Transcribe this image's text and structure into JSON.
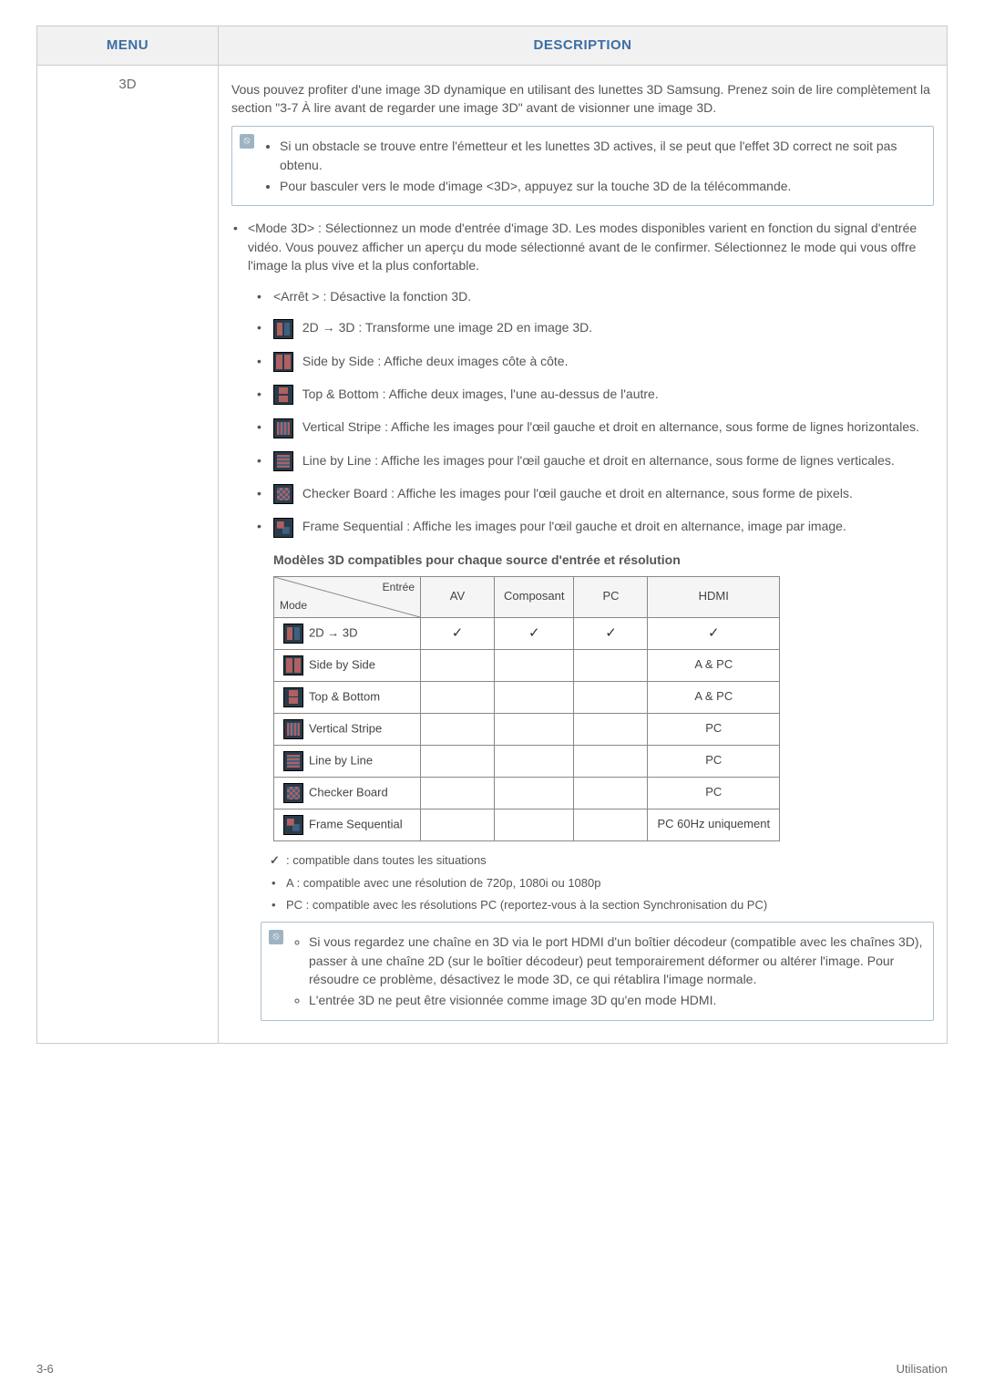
{
  "header": {
    "col_menu": "MENU",
    "col_desc": "DESCRIPTION"
  },
  "menu": {
    "item": "3D"
  },
  "intro": "Vous pouvez profiter d'une image 3D dynamique en utilisant des lunettes 3D Samsung. Prenez soin de lire complètement la section \"3-7 À lire avant de regarder une image 3D\" avant de visionner une image 3D.",
  "info_top": {
    "items": [
      "Si un obstacle se trouve entre l'émetteur et les lunettes 3D actives, il se peut que l'effet 3D correct ne soit pas obtenu.",
      "Pour basculer vers le mode d'image <3D>, appuyez sur la touche 3D de la télécommande."
    ]
  },
  "mode3d": {
    "title": "<Mode 3D> : Sélectionnez un mode d'entrée d'image 3D. Les modes disponibles varient en fonction du signal d'entrée vidéo. Vous pouvez afficher un aperçu du mode sélectionné avant de le confirmer. Sélectionnez le mode qui vous offre l'image la plus vive et la plus confortable.",
    "sub": [
      "<Arrêt > : Désactive la fonction 3D.",
      "2D → 3D : Transforme une image 2D en image 3D.",
      "Side by Side : Affiche deux images côte à côte.",
      "Top & Bottom : Affiche deux images, l'une au-dessus de l'autre.",
      "Vertical Stripe : Affiche les images pour l'œil gauche et droit en alternance, sous forme de lignes horizontales.",
      "Line by Line : Affiche les images pour l'œil gauche et droit en alternance, sous forme de lignes verticales.",
      "Checker Board : Affiche les images pour l'œil gauche et droit en alternance, sous forme de pixels.",
      "Frame Sequential : Affiche les images pour l'œil gauche et droit en alternance, image par image."
    ]
  },
  "section_heading": "Modèles 3D compatibles pour chaque source d'entrée et résolution",
  "inner_table": {
    "diag_top": "Entrée",
    "diag_bottom": "Mode",
    "cols": [
      "AV",
      "Composant",
      "PC",
      "HDMI"
    ],
    "rows": [
      {
        "icon": "arrow2d3d",
        "label": "2D → 3D",
        "cells": [
          "✓",
          "✓",
          "✓",
          "✓"
        ]
      },
      {
        "icon": "sbs",
        "label": "Side by Side",
        "cells": [
          "",
          "",
          "",
          "A & PC"
        ]
      },
      {
        "icon": "tb",
        "label": "Top & Bottom",
        "cells": [
          "",
          "",
          "",
          "A & PC"
        ]
      },
      {
        "icon": "vstripe",
        "label": "Vertical Stripe",
        "cells": [
          "",
          "",
          "",
          "PC"
        ]
      },
      {
        "icon": "lbl",
        "label": "Line by Line",
        "cells": [
          "",
          "",
          "",
          "PC"
        ]
      },
      {
        "icon": "checker",
        "label": "Checker Board",
        "cells": [
          "",
          "",
          "",
          "PC"
        ]
      },
      {
        "icon": "frameseq",
        "label": "Frame Sequential",
        "cells": [
          "",
          "",
          "",
          "PC 60Hz uniquement"
        ]
      }
    ]
  },
  "footnotes": {
    "compat_all": ": compatible dans toutes les situations",
    "a_note": "A : compatible avec une résolution de 720p, 1080i ou 1080p",
    "pc_note": "PC : compatible avec les résolutions PC (reportez-vous à la section Synchronisation du PC)"
  },
  "info_bottom": {
    "items": [
      "Si vous regardez une chaîne en 3D via le port HDMI d'un boîtier décodeur (compatible avec les chaînes 3D), passer à une chaîne 2D (sur le boîtier décodeur) peut temporairement déformer ou altérer l'image. Pour résoudre ce problème, désactivez le mode 3D, ce qui rétablira l'image normale.",
      "L'entrée 3D ne peut être visionnée comme image 3D qu'en mode HDMI."
    ]
  },
  "footer": {
    "left": "3-6",
    "right": "Utilisation"
  }
}
